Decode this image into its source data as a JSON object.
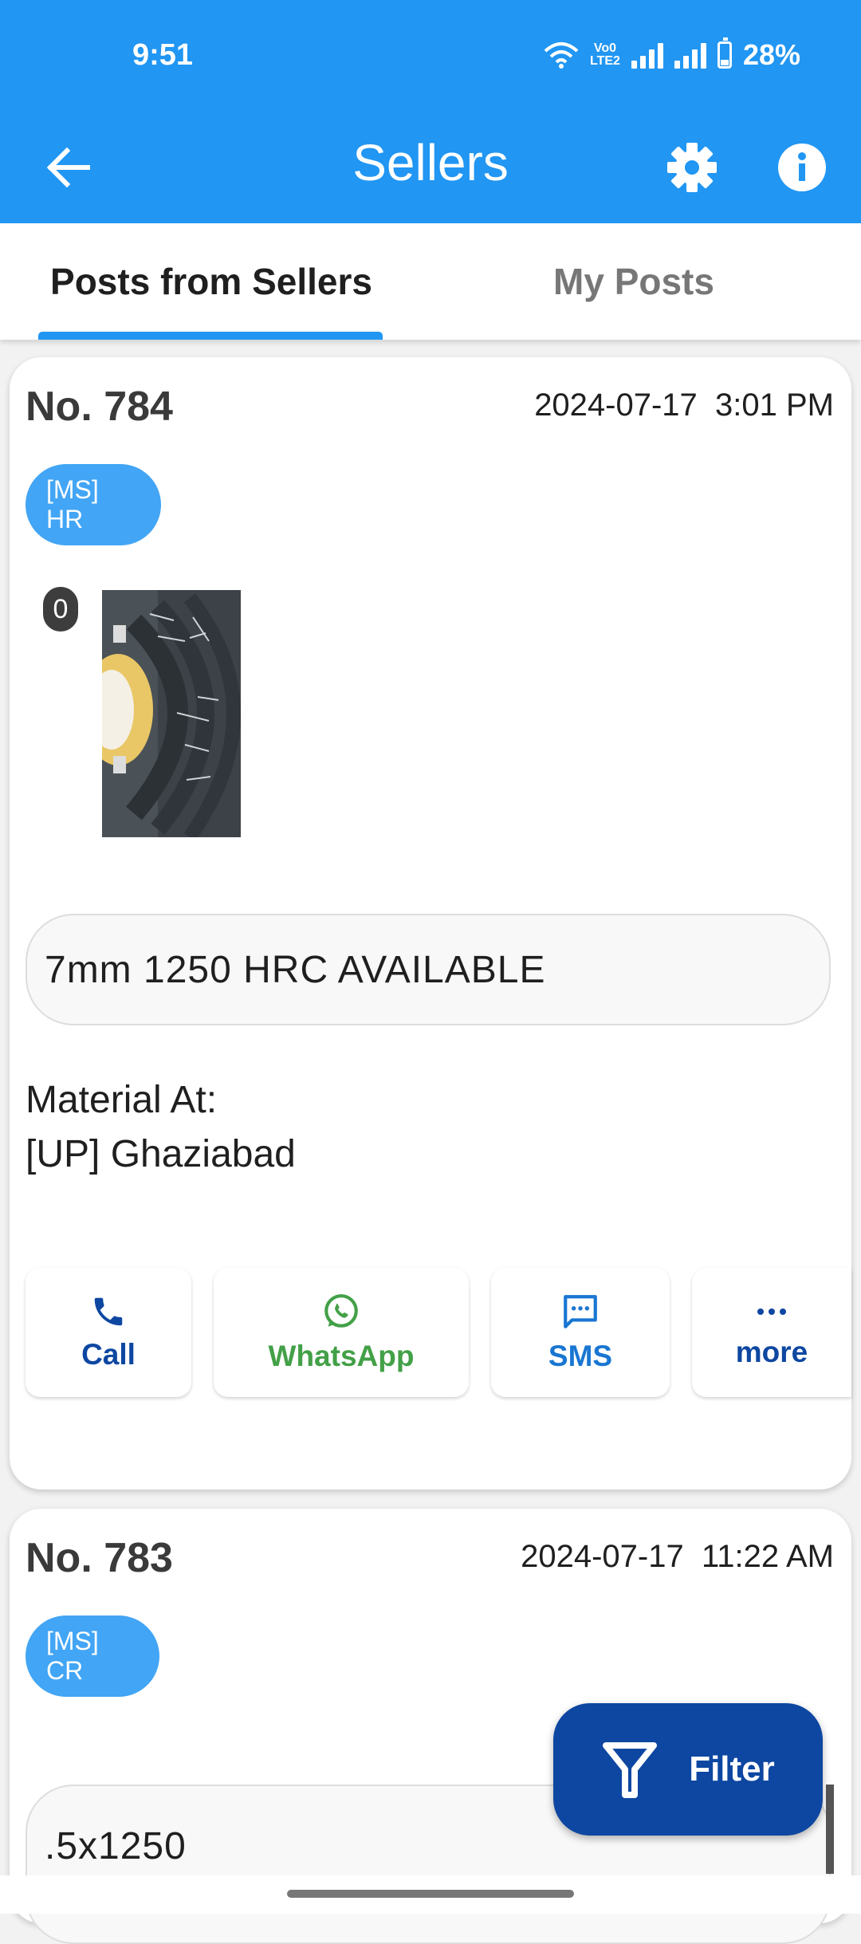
{
  "status_bar": {
    "time": "9:51",
    "volte_label": "Vo0\nLTE2",
    "battery": "28%"
  },
  "app_bar": {
    "title": "Sellers",
    "back_icon": "arrow-left-icon",
    "settings_icon": "gear-icon",
    "info_icon": "info-icon"
  },
  "tabs": [
    {
      "label": "Posts from Sellers",
      "selected": true
    },
    {
      "label": "My Posts",
      "selected": false
    }
  ],
  "posts": [
    {
      "number": "No. 784",
      "datetime": "2024-07-17  3:01 PM",
      "tag": "[MS] HR",
      "image_count": "0",
      "description": "7mm 1250 HRC AVAILABLE",
      "material_label": "Material At:",
      "location": "[UP] Ghaziabad",
      "actions": [
        {
          "label": "Call",
          "icon": "phone-icon",
          "color": "#0D47A1"
        },
        {
          "label": "WhatsApp",
          "icon": "whatsapp-icon",
          "color": "#43A047"
        },
        {
          "label": "SMS",
          "icon": "sms-icon",
          "color": "#1976D2"
        },
        {
          "label": "more",
          "icon": "more-dots-icon",
          "color": "#0D47A1"
        }
      ]
    },
    {
      "number": "No. 783",
      "datetime": "2024-07-17  11:22 AM",
      "tag": "[MS] CR",
      "description": ".5x1250"
    }
  ],
  "filter_button": {
    "label": "Filter",
    "icon": "filter-funnel-icon"
  },
  "colors": {
    "primary": "#2196F3",
    "tag": "#42A5F5",
    "fab": "#0D47A1",
    "call": "#0D47A1",
    "whatsapp": "#43A047",
    "sms": "#1976D2"
  }
}
